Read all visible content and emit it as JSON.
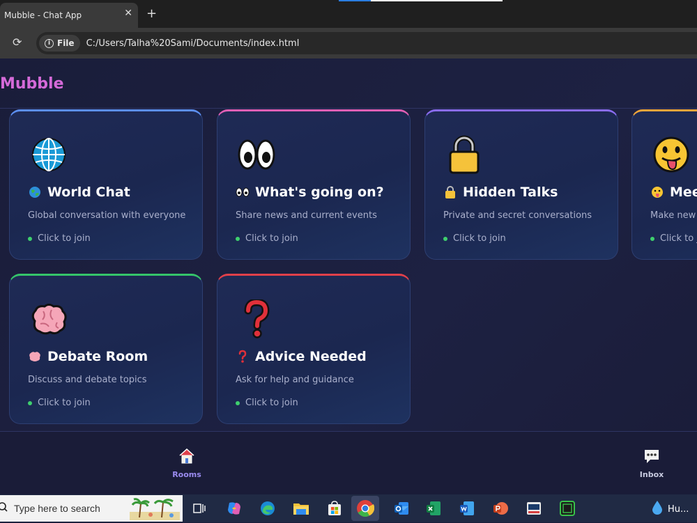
{
  "browser": {
    "tab_title": "Mubble - Chat App",
    "close_glyph": "✕",
    "new_tab_glyph": "+",
    "reload_glyph": "⟳",
    "file_chip_label": "File",
    "url": "C:/Users/Talha%20Sami/Documents/index.html"
  },
  "app": {
    "brand": "Mubble",
    "brand_color": "#d46ad8"
  },
  "rooms": [
    {
      "name": "World Chat",
      "description": "Global conversation with everyone",
      "join_label": "Click to join",
      "icon": "globe-icon",
      "accent": "#5b8ef0"
    },
    {
      "name": "What's going on?",
      "description": "Share news and current events",
      "join_label": "Click to join",
      "icon": "eyes-icon",
      "accent": "#e05fb5"
    },
    {
      "name": "Hidden Talks",
      "description": "Private and secret conversations",
      "join_label": "Click to join",
      "icon": "lock-icon",
      "accent": "#8a6cf0"
    },
    {
      "name": "Mee",
      "description": "Make new f",
      "join_label": "Click to jo",
      "icon": "tongue-face-icon",
      "accent": "#f0a53a"
    },
    {
      "name": "Debate Room",
      "description": "Discuss and debate topics",
      "join_label": "Click to join",
      "icon": "brain-icon",
      "accent": "#35c46a"
    },
    {
      "name": "Advice Needed",
      "description": "Ask for help and guidance",
      "join_label": "Click to join",
      "icon": "question-icon",
      "accent": "#e0404a"
    }
  ],
  "nav": {
    "rooms_label": "Rooms",
    "inbox_label": "Inbox",
    "active_color": "#9b8cf0"
  },
  "taskbar": {
    "search_placeholder": "Type here to search",
    "tray_label": "Hu..."
  }
}
